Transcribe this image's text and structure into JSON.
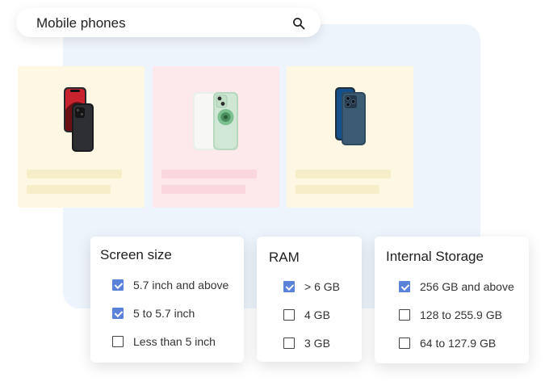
{
  "search": {
    "query": "Mobile phones",
    "icon": "search-icon"
  },
  "products": [
    {
      "card_color": "#fdf7e3",
      "bar_color": "#f7edc8",
      "phone": "iphone-12-black-red",
      "selected": false
    },
    {
      "card_color": "#fde8ec",
      "bar_color": "#fad7df",
      "phone": "iphone-12-green",
      "selected": false
    },
    {
      "card_color": "#fdf7e3",
      "bar_color": "#f7edc8",
      "phone": "iphone-12-pro-blue",
      "selected": false
    }
  ],
  "filters": {
    "screen": {
      "title": "Screen size",
      "options": [
        {
          "label": "5.7 inch and above",
          "checked": true
        },
        {
          "label": "5 to 5.7 inch",
          "checked": true
        },
        {
          "label": "Less than 5 inch",
          "checked": false
        }
      ]
    },
    "ram": {
      "title": "RAM",
      "options": [
        {
          "label": "> 6 GB",
          "checked": true
        },
        {
          "label": "4 GB",
          "checked": false
        },
        {
          "label": "3 GB",
          "checked": false
        }
      ]
    },
    "storage": {
      "title": "Internal Storage",
      "options": [
        {
          "label": "256 GB and above",
          "checked": true
        },
        {
          "label": "128 to 255.9 GB",
          "checked": false
        },
        {
          "label": "64 to 127.9 GB",
          "checked": false
        }
      ]
    }
  },
  "colors": {
    "accent": "#5b82d9",
    "backdrop": "#edf4fb"
  }
}
